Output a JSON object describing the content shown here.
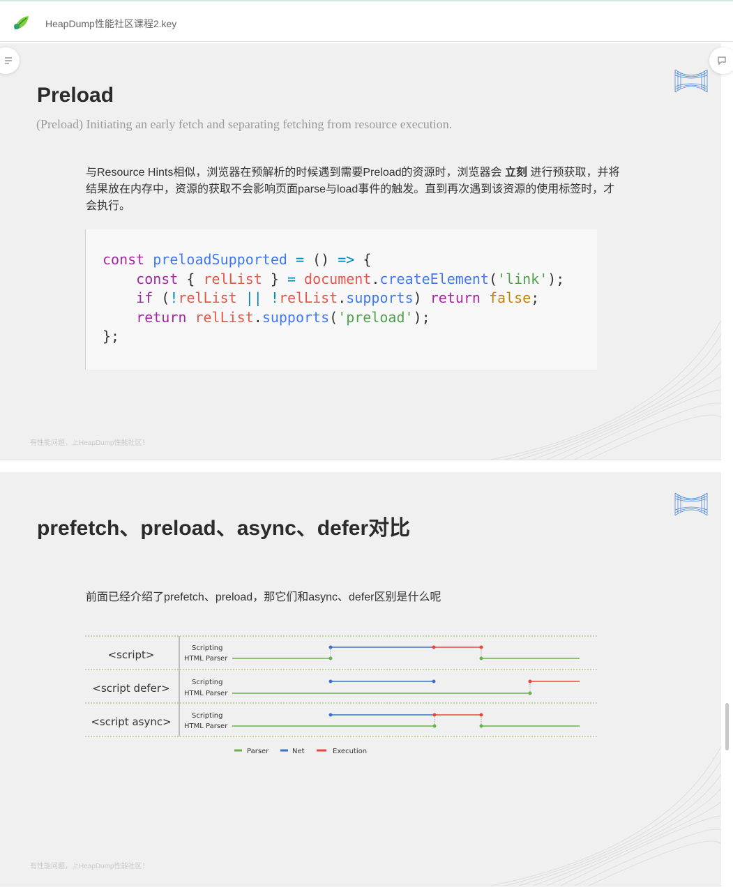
{
  "app": {
    "title": "HeapDump性能社区课程2.key"
  },
  "slide1": {
    "title": "Preload",
    "subtitle": "(Preload) Initiating an early fetch and separating fetching from resource execution.",
    "body_part1": "与Resource Hints相似，浏览器在预解析的时候遇到需要Preload的资源时，浏览器会 ",
    "body_bold": "立刻",
    "body_part2": " 进行预获取，并将结果放在内存中，资源的获取不会影响页面parse与load事件的触发。直到再次遇到该资源的使用标签时，才会执行。",
    "code": {
      "line1": "const preloadSupported = () => {",
      "line2": "    const { relList } = document.createElement('link');",
      "line3": "    if (!relList || !relList.supports) return false;",
      "line4": "    return relList.supports('preload');",
      "line5": "};"
    },
    "footer": "有性能问题，上HeapDump性能社区！"
  },
  "slide2": {
    "title": "prefetch、preload、async、defer对比",
    "body": "前面已经介绍了prefetch、preload，那它们和async、defer区别是什么呢",
    "diagram": {
      "rows": [
        {
          "label": "<script>",
          "lane_top": "Scripting",
          "lane_bottom": "HTML Parser"
        },
        {
          "label": "<script defer>",
          "lane_top": "Scripting",
          "lane_bottom": "HTML Parser"
        },
        {
          "label": "<script async>",
          "lane_top": "Scripting",
          "lane_bottom": "HTML Parser"
        }
      ],
      "legend": [
        {
          "label": "Parser",
          "color": "#6ab04c"
        },
        {
          "label": "Net",
          "color": "#3d6fc4"
        },
        {
          "label": "Execution",
          "color": "#e8453c"
        }
      ]
    },
    "footer": "有性能问题，上HeapDump性能社区！"
  },
  "colors": {
    "parser": "#6ab04c",
    "net": "#3d6fc4",
    "execution": "#e8453c"
  },
  "icons": {
    "app_logo": "leaf-logo-icon",
    "outline_button": "outline-list-icon",
    "comment_button": "comment-icon",
    "slide_logo": "bowtie-logo-icon"
  }
}
